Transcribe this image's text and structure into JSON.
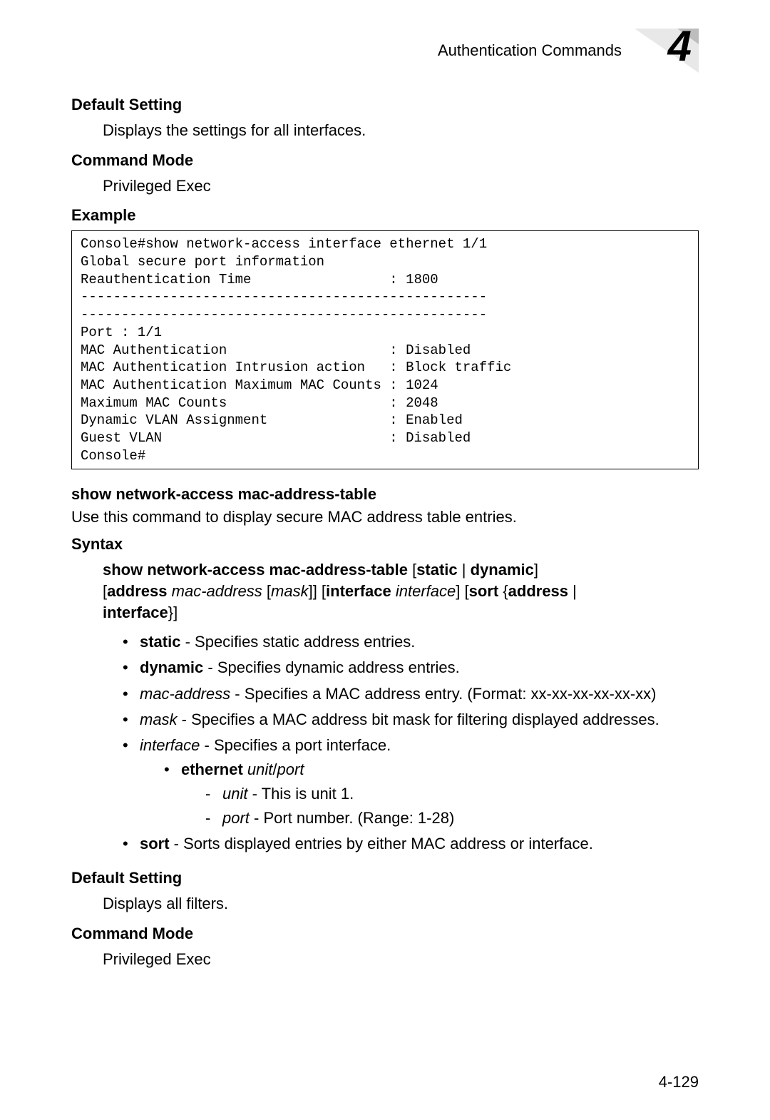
{
  "header": {
    "title": "Authentication Commands",
    "chapter": "4"
  },
  "sections": {
    "default_setting_1": {
      "heading": "Default Setting",
      "text": "Displays the settings for all interfaces."
    },
    "command_mode_1": {
      "heading": "Command Mode",
      "text": "Privileged Exec"
    },
    "example_heading": "Example",
    "example_output": "Console#show network-access interface ethernet 1/1\nGlobal secure port information\nReauthentication Time                 : 1800\n--------------------------------------------------\n--------------------------------------------------\nPort : 1/1\nMAC Authentication                    : Disabled\nMAC Authentication Intrusion action   : Block traffic\nMAC Authentication Maximum MAC Counts : 1024\nMaximum MAC Counts                    : 2048\nDynamic VLAN Assignment               : Enabled\nGuest VLAN                            : Disabled\nConsole#",
    "command_title": "show network-access mac-address-table",
    "command_desc": "Use this command to display secure MAC address table entries.",
    "syntax_heading": "Syntax",
    "syntax": {
      "line1_bold": "show network-access mac-address-table",
      "line1_rest_a": " [",
      "line1_static": "static",
      "line1_pipe": " | ",
      "line1_dynamic": "dynamic",
      "line1_rest_b": "]",
      "line2_open": "[",
      "line2_address": "address",
      "line2_mac": " mac-address",
      "line2_open2": " [",
      "line2_mask": "mask",
      "line2_close2": "]] [",
      "line2_interface_kw": "interface",
      "line2_interface_it": " interface",
      "line2_close_open": "] [",
      "line2_sort": "sort",
      "line2_brace": " {",
      "line2_address2": "address",
      "line2_pipe2": " |",
      "line3_interface": "interface",
      "line3_close": "}]"
    },
    "bullets": {
      "static": {
        "kw": "static",
        "desc": " - Specifies static address entries."
      },
      "dynamic": {
        "kw": "dynamic",
        "desc": " - Specifies dynamic address entries."
      },
      "mac": {
        "kw": "mac-address",
        "desc": " - Specifies a MAC address entry. (Format: xx-xx-xx-xx-xx-xx)"
      },
      "mask": {
        "kw": "mask",
        "desc": " - Specifies a MAC address bit mask for filtering displayed addresses."
      },
      "interface": {
        "kw": "interface",
        "desc": " - Specifies a port interface."
      },
      "ethernet": {
        "kw": "ethernet",
        "it": " unit",
        "slash": "/",
        "it2": "port"
      },
      "unit": {
        "kw": "unit",
        "desc": " - This is unit 1."
      },
      "port": {
        "kw": "port",
        "desc": " - Port number. (Range: 1-28)"
      },
      "sort": {
        "kw": "sort",
        "desc": " - Sorts displayed entries by either MAC address or interface."
      }
    },
    "default_setting_2": {
      "heading": "Default Setting",
      "text": "Displays all filters."
    },
    "command_mode_2": {
      "heading": "Command Mode",
      "text": "Privileged Exec"
    }
  },
  "page_number": "4-129"
}
